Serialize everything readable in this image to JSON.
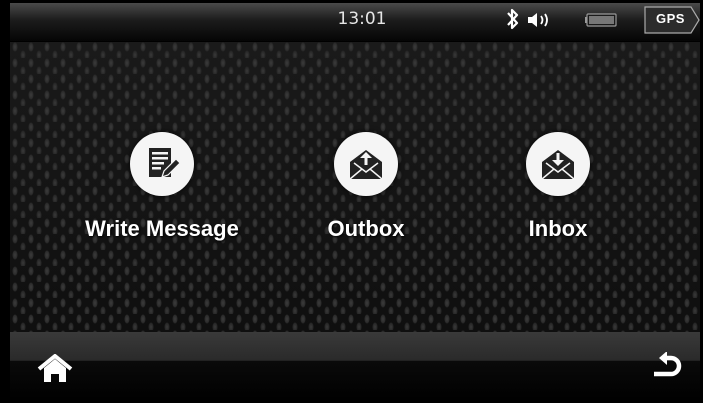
{
  "status_bar": {
    "time": "13:01",
    "gps_label": "GPS",
    "icons": [
      "bluetooth-icon",
      "volume-icon",
      "battery-icon",
      "gps-icon"
    ]
  },
  "menu": {
    "items": [
      {
        "label": "Write Message",
        "icon": "write-message-icon"
      },
      {
        "label": "Outbox",
        "icon": "outbox-icon"
      },
      {
        "label": "Inbox",
        "icon": "inbox-icon"
      }
    ]
  },
  "bottom_bar": {
    "icons": [
      "home-icon",
      "back-icon"
    ]
  }
}
